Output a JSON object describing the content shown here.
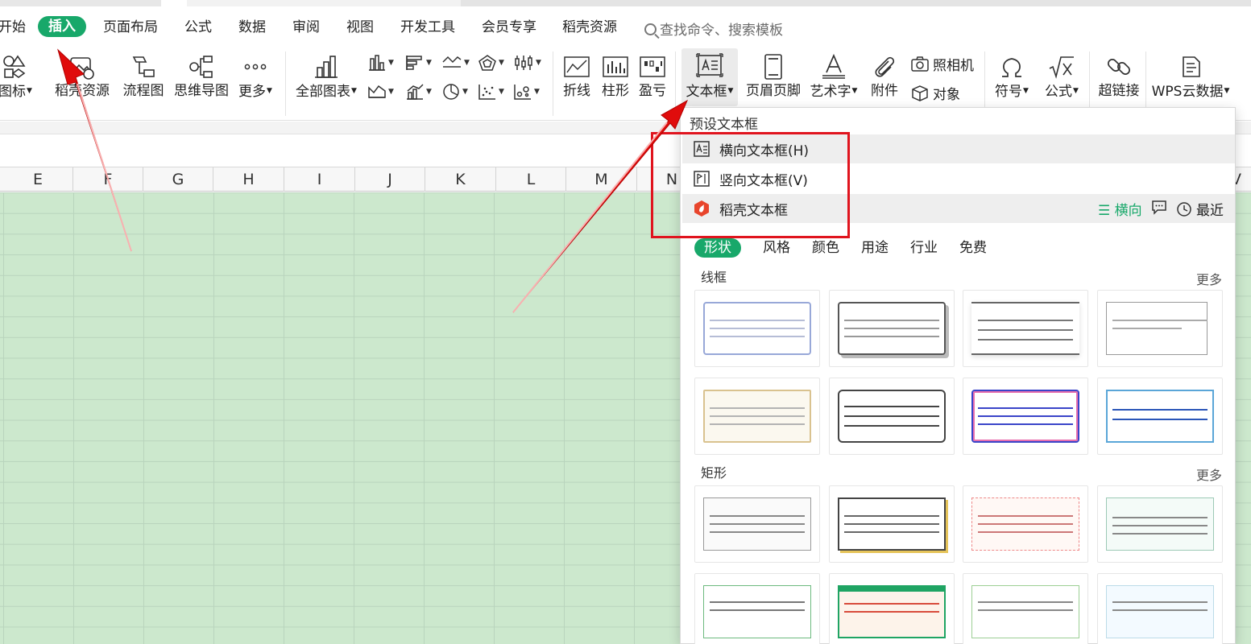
{
  "menu": {
    "items": [
      "开始",
      "插入",
      "页面布局",
      "公式",
      "数据",
      "审阅",
      "视图",
      "开发工具",
      "会员专享",
      "稻壳资源"
    ],
    "active": "插入",
    "search_placeholder": "查找命令、搜索模板"
  },
  "ribbon": {
    "icons_label": "图标",
    "docer_resources": "稻壳资源",
    "flowchart": "流程图",
    "mindmap": "思维导图",
    "more": "更多",
    "all_charts": "全部图表",
    "line": "折线",
    "column": "柱形",
    "winloss": "盈亏",
    "textbox": "文本框",
    "header_footer": "页眉页脚",
    "wordart": "艺术字",
    "attachment": "附件",
    "camera": "照相机",
    "object": "对象",
    "symbol": "符号",
    "formula": "公式",
    "hyperlink": "超链接",
    "wps_cloud": "WPS云数据"
  },
  "columns": [
    "E",
    "F",
    "G",
    "H",
    "I",
    "J",
    "K",
    "L",
    "M",
    "N",
    "V"
  ],
  "dropdown": {
    "header": "预设文本框",
    "options": [
      "横向文本框(H)",
      "竖向文本框(V)",
      "稻壳文本框"
    ],
    "orientation": "横向",
    "recent": "最近",
    "categories": [
      "形状",
      "风格",
      "颜色",
      "用途",
      "行业",
      "免费"
    ],
    "sections": [
      {
        "title": "线框",
        "more": "更多"
      },
      {
        "title": "矩形",
        "more": "更多"
      }
    ]
  },
  "colors": {
    "accent": "#18a86a",
    "grid_bg": "#cce8cd",
    "highlight": "#e0141e"
  }
}
